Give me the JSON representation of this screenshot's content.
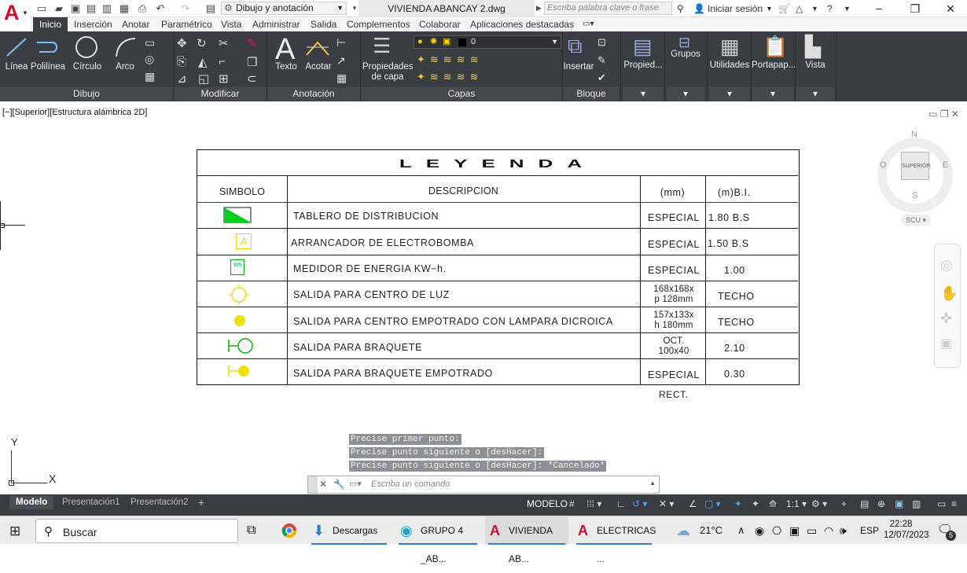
{
  "titlebar": {
    "workspace": "Dibujo y anotación",
    "document": "VIVIENDA ABANCAY 2.dwg",
    "search_placeholder": "Escriba palabra clave o frase",
    "signin": "Iniciar sesión"
  },
  "ribbon_tabs": [
    "Inicio",
    "Inserción",
    "Anotar",
    "Paramétrico",
    "Vista",
    "Administrar",
    "Salida",
    "Complementos",
    "Colaborar",
    "Aplicaciones destacadas"
  ],
  "ribbon": {
    "dibujo_buttons": [
      "Línea",
      "Polilínea",
      "Círculo",
      "Arco"
    ],
    "dibujo_title": "Dibujo",
    "modificar_title": "Modificar",
    "texto": "Texto",
    "acotar": "Acotar",
    "anotacion_title": "Anotación",
    "propiedades_capa_1": "Propiedades",
    "propiedades_capa_2": "de capa",
    "layer_value": "0",
    "capas_title": "Capas",
    "insertar": "Insertar",
    "bloque_title": "Bloque",
    "propied": "Propied...",
    "grupos": "Grupos",
    "utilidades": "Utilidades",
    "portapap": "Portapap...",
    "vista": "Vista"
  },
  "viewport": {
    "label": "[−][Superior][Estructura alámbrica 2D]",
    "viewcube_label": "SUPERIOR",
    "compass_n": "N",
    "compass_s": "S",
    "compass_e": "E",
    "compass_w": "O",
    "scu": "SCU",
    "ucs_x": "X",
    "ucs_y": "Y"
  },
  "legend": {
    "title": "LEYENDA",
    "headers": [
      "SIMBOLO",
      "DESCRIPCION",
      "(mm)",
      "(m)B.I."
    ],
    "rows": [
      {
        "desc": "TABLERO  DE  DISTRIBUCION",
        "mm": "ESPECIAL",
        "bi": "1.80  B.S"
      },
      {
        "desc": "ARRANCADOR  DE  ELECTROBOMBA",
        "mm": "ESPECIAL",
        "bi": "1.50  B.S"
      },
      {
        "desc": "MEDIDOR  DE  ENERGIA    KW−h.",
        "mm": "ESPECIAL",
        "bi": "1.00"
      },
      {
        "desc": "SALIDA  PARA  CENTRO  DE  LUZ",
        "mm1": "168x168x",
        "mm2": "p  128mm",
        "bi": "TECHO"
      },
      {
        "desc": "SALIDA  PARA  CENTRO  EMPOTRADO  CON  LAMPARA  DICROICA",
        "mm1": "157x133x",
        "mm2": "h  180mm",
        "bi": "TECHO"
      },
      {
        "desc": "SALIDA  PARA  BRAQUETE",
        "mm1": "OCT.",
        "mm2": "100x40",
        "bi": "2.10"
      },
      {
        "desc": "SALIDA  PARA  BRAQUETE  EMPOTRADO",
        "mm": "ESPECIAL",
        "bi": "0.30"
      }
    ],
    "footer": "RECT.",
    "meter_symbol": "Wh",
    "arrancador_symbol": "A"
  },
  "command": {
    "history": [
      "Precise primer punto:",
      "Precise punto siguiente o [desHacer]:",
      "Precise punto siguiente o [desHacer]: *Cancelado*"
    ],
    "placeholder": "Escriba un comando"
  },
  "layout_tabs": [
    "Modelo",
    "Presentación1",
    "Presentación2",
    "+"
  ],
  "status": {
    "model": "MODELO",
    "scale": "1:1"
  },
  "taskbar": {
    "search": "Buscar",
    "apps": [
      "Descargas",
      "GRUPO 4 _AB...",
      "VIVIENDA AB...",
      "ELECTRICAS ..."
    ],
    "temp": "21°C",
    "lang": "ESP",
    "time": "22:28",
    "date": "12/07/2023",
    "notif": "5"
  }
}
